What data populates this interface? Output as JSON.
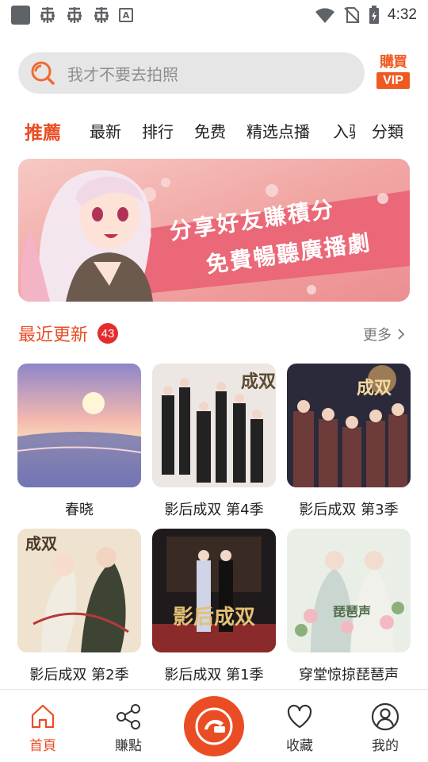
{
  "status_bar": {
    "time": "4:32",
    "notification_icon": "A"
  },
  "search": {
    "placeholder": "我才不要去拍照"
  },
  "vip": {
    "line1": "購買",
    "line2": "VIP"
  },
  "tabs": [
    {
      "label": "推薦"
    },
    {
      "label": "最新"
    },
    {
      "label": "排行"
    },
    {
      "label": "免费"
    },
    {
      "label": "精选点播"
    },
    {
      "label": "入驻"
    },
    {
      "label": "分類"
    }
  ],
  "banner": {
    "line1": "分享好友賺積分",
    "line2": "免費暢聽廣播劇"
  },
  "section": {
    "title": "最近更新",
    "count": "43",
    "more": "更多"
  },
  "items": [
    {
      "title": "春晓"
    },
    {
      "title": "影后成双 第4季"
    },
    {
      "title": "影后成双 第3季"
    },
    {
      "title": "影后成双 第2季"
    },
    {
      "title": "影后成双 第1季"
    },
    {
      "title": "穿堂惊掠琵琶声"
    }
  ],
  "bottom_nav": [
    {
      "label": "首頁",
      "icon": "home-icon"
    },
    {
      "label": "賺點",
      "icon": "share-icon"
    },
    {
      "label": "收藏",
      "icon": "heart-icon"
    },
    {
      "label": "我的",
      "icon": "user-icon"
    }
  ],
  "colors": {
    "accent": "#ea4d24",
    "badge": "#e52c2c",
    "search_bg": "#e6e6e6"
  }
}
